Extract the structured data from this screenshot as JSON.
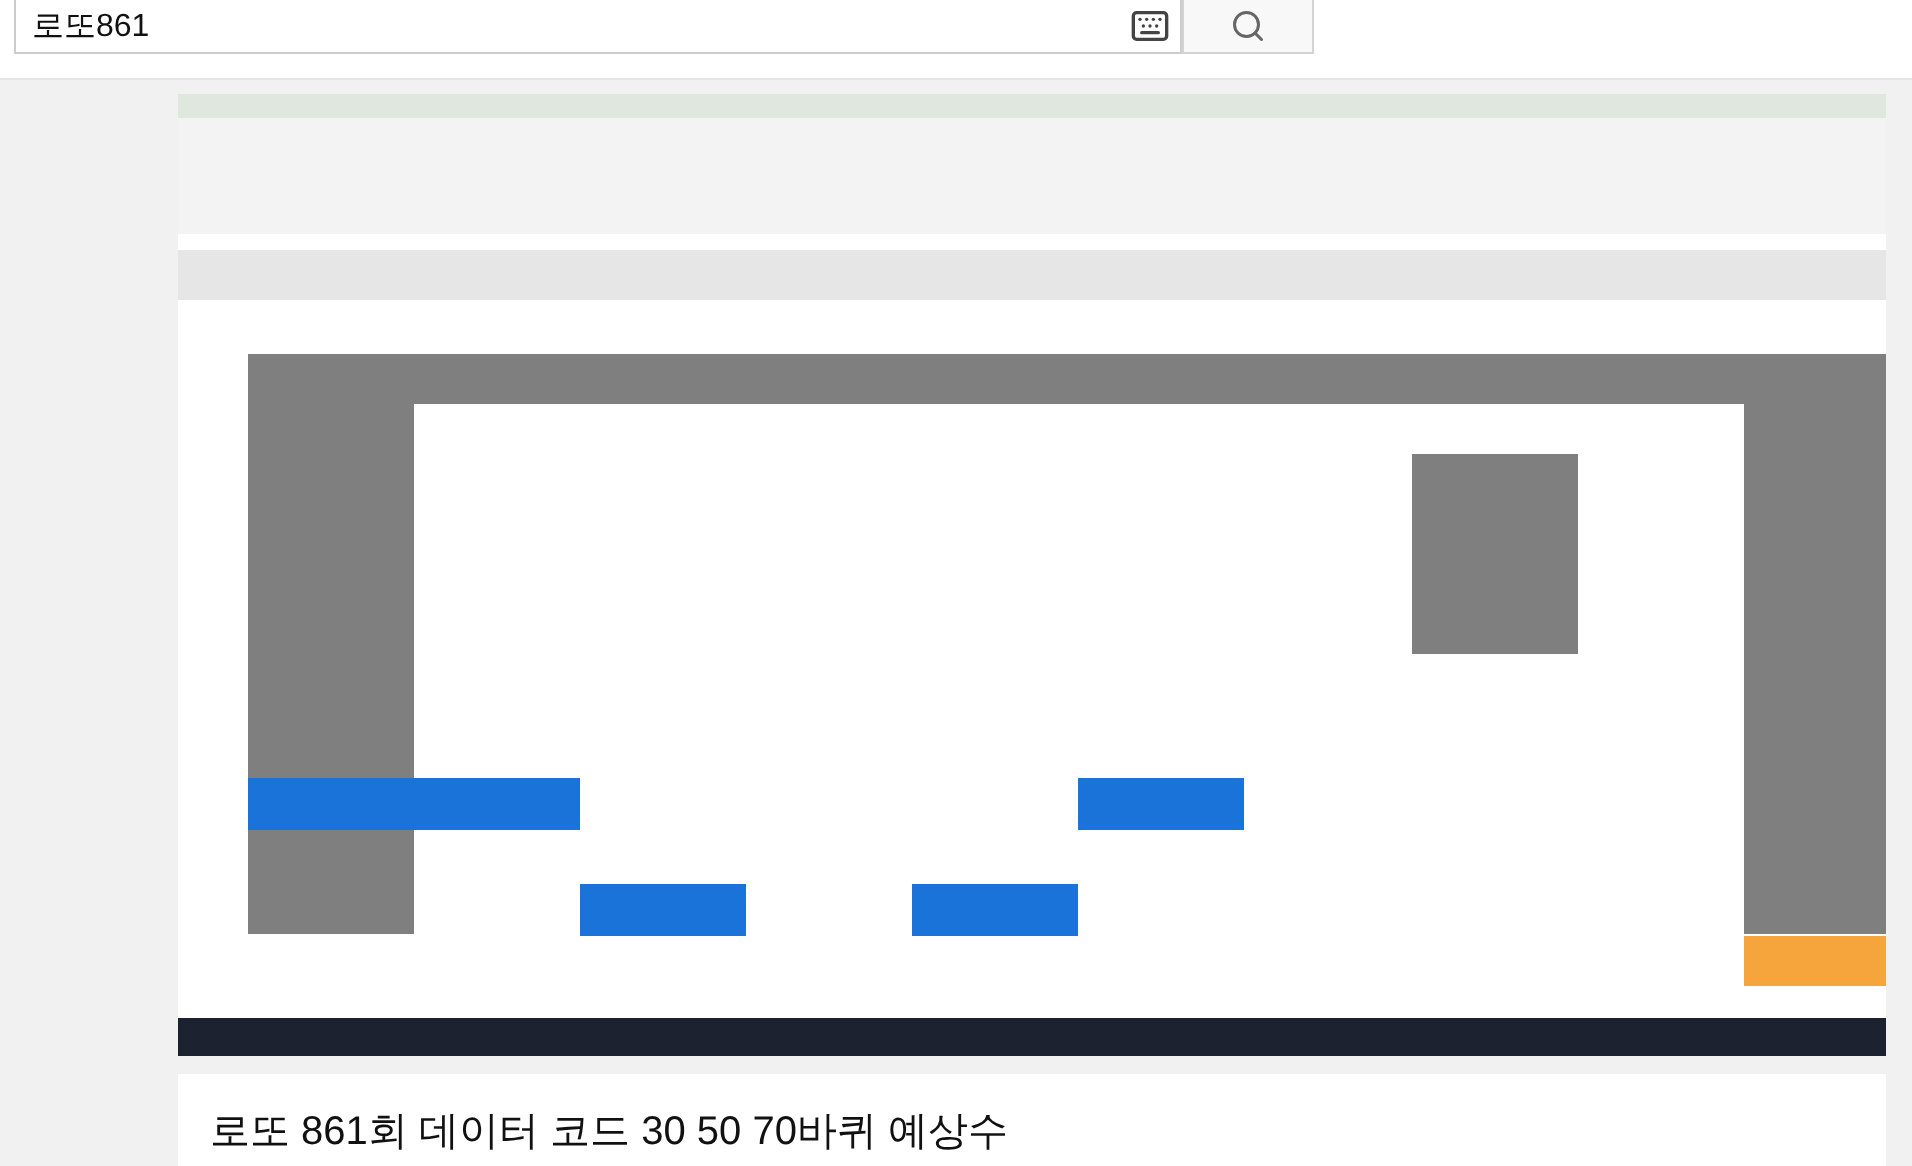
{
  "search": {
    "value": "로또861"
  },
  "title": "로또 861회 데이터 코드 30 50 70바퀴 예상수"
}
